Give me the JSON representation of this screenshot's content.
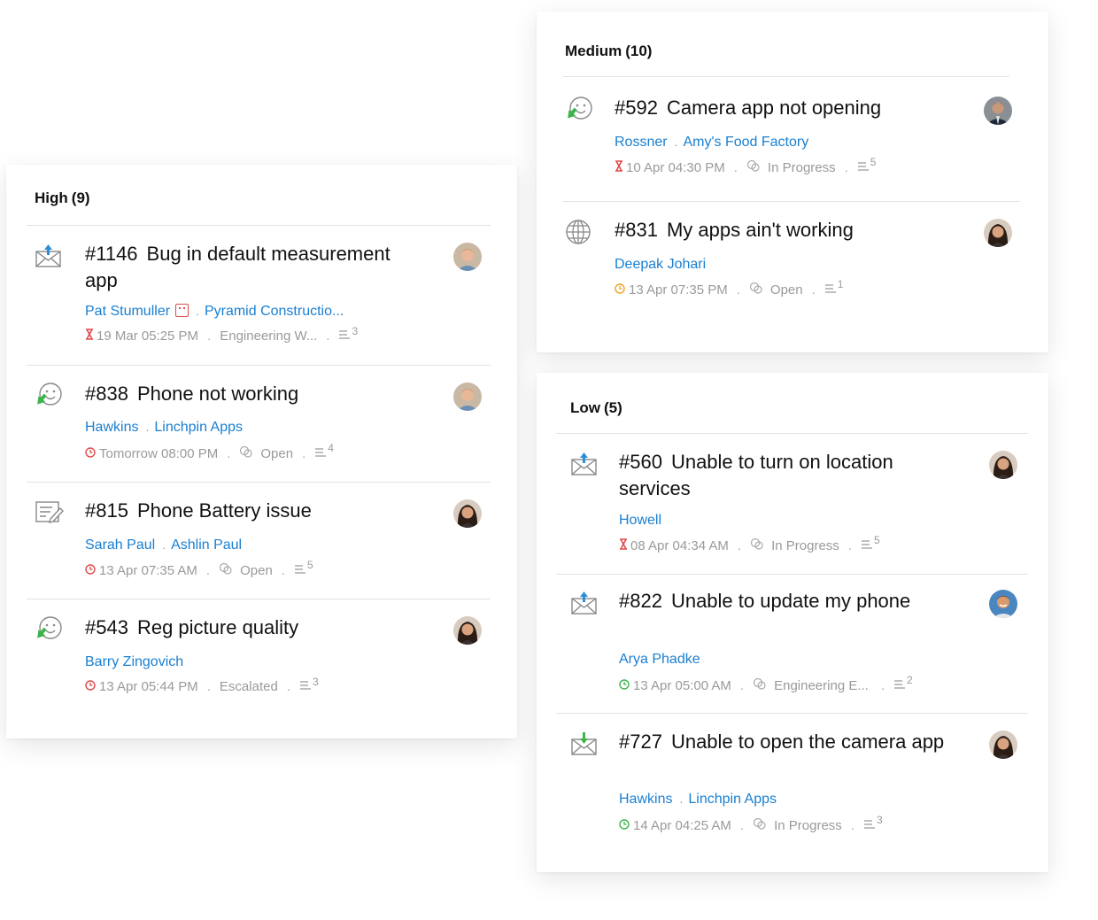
{
  "panels": [
    {
      "title": "High",
      "count": "(9)",
      "tickets": [
        {
          "icon": "email-icon",
          "number": "#1146",
          "subject": "Bug in default measurement app",
          "contact": "Pat Stumuller",
          "account": "Pyramid Constructio...",
          "time": "19 Mar 05:25 PM",
          "time_icon": "hourglass-icon",
          "status": "Engineering W...",
          "threads": "3",
          "avatar": "man-blond"
        },
        {
          "icon": "feedback-icon",
          "number": "#838",
          "subject": "Phone not working",
          "contact": "Hawkins",
          "account": "Linchpin Apps",
          "time": "Tomorrow 08:00 PM",
          "time_icon": "clock-red-icon",
          "status": "Open",
          "threads": "4",
          "avatar": "man-blond"
        },
        {
          "icon": "form-icon",
          "number": "#815",
          "subject": "Phone Battery issue",
          "contact": "Sarah Paul",
          "account": "Ashlin Paul",
          "time": "13 Apr 07:35 AM",
          "time_icon": "clock-red-icon",
          "status": "Open",
          "threads": "5",
          "avatar": "woman-dark"
        },
        {
          "icon": "feedback-icon",
          "number": "#543",
          "subject": "Reg picture quality",
          "contact": "Barry Zingovich",
          "account": "",
          "time": "13 Apr 05:44 PM",
          "time_icon": "clock-red-icon",
          "status": "Escalated",
          "threads": "3",
          "avatar": "woman-dark"
        }
      ]
    },
    {
      "title": "Medium",
      "count": "(10)",
      "tickets": [
        {
          "icon": "feedback-icon",
          "number": "#592",
          "subject": "Camera app not opening",
          "contact": "Rossner",
          "account": "Amy's Food Factory",
          "time": "10 Apr 04:30 PM",
          "time_icon": "hourglass-icon",
          "status": "In Progress",
          "threads": "5",
          "avatar": "man-suit"
        },
        {
          "icon": "globe-icon",
          "number": "#831",
          "subject": "My apps ain't working",
          "contact": "Deepak Johari",
          "account": "",
          "time": "13 Apr 07:35 PM",
          "time_icon": "clock-orange-icon",
          "status": "Open",
          "threads": "1",
          "avatar": "woman-dark"
        }
      ]
    },
    {
      "title": "Low",
      "count": "(5)",
      "tickets": [
        {
          "icon": "email-icon",
          "number": "#560",
          "subject": "Unable to turn on location services",
          "contact": "Howell",
          "account": "",
          "time": "08 Apr 04:34 AM",
          "time_icon": "hourglass-icon",
          "status": "In Progress",
          "threads": "5",
          "avatar": "woman-dark"
        },
        {
          "icon": "email-icon",
          "number": "#822",
          "subject": "Unable to update my phone",
          "contact": "Arya Phadke",
          "account": "",
          "time": "13 Apr 05:00 AM",
          "time_icon": "clock-green-icon",
          "status": "Engineering E...",
          "threads": "2",
          "avatar": "man-smile"
        },
        {
          "icon": "email-in-icon",
          "number": "#727",
          "subject": "Unable to open the camera app",
          "contact": "Hawkins",
          "account": "Linchpin Apps",
          "time": "14 Apr 04:25 AM",
          "time_icon": "clock-green-icon",
          "status": "In Progress",
          "threads": "3",
          "avatar": "woman-dark"
        }
      ]
    }
  ],
  "colors": {
    "link": "#1a7fd0",
    "meta": "#9a9a9a",
    "overdue": "#e04a4a",
    "due_soon": "#f0a020",
    "on_time": "#3cb44b",
    "arrow_blue": "#2a8fd8",
    "arrow_green": "#3cb44b"
  }
}
